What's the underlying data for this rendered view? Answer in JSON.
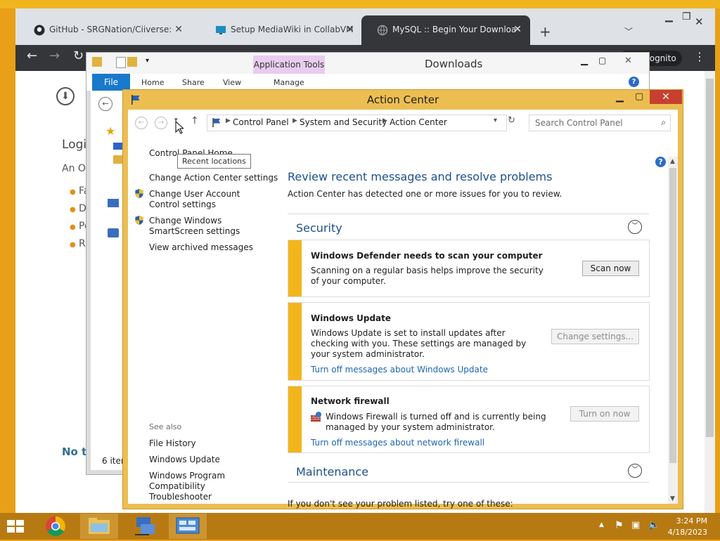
{
  "chrome": {
    "tabs": [
      {
        "title": "GitHub - SRGNation/Ciiverse: My",
        "close": "✕"
      },
      {
        "title": "Setup MediaWiki in CollabVM - C",
        "close": "✕"
      },
      {
        "title": "MySQL :: Begin Your Download",
        "close": "✕"
      }
    ],
    "new_tab": "+",
    "incognito_label": "Incognito",
    "page": {
      "heading_fragment": "Logi",
      "line_fragment": "An O",
      "bullets": [
        "Fa",
        "D",
        "Pe",
        "R"
      ],
      "footer_fragment": "No th"
    }
  },
  "explorer": {
    "title": "Downloads",
    "app_tools": "Application Tools",
    "file_tab": "File",
    "tabs": [
      "Home",
      "Share",
      "View",
      "Manage"
    ],
    "status": "6 item"
  },
  "action_center": {
    "title": "Action Center",
    "breadcrumb": [
      "Control Panel",
      "System and Security",
      "Action Center"
    ],
    "search_placeholder": "Search Control Panel",
    "tooltip": "Recent locations",
    "left_nav": {
      "home": "Control Panel Home",
      "links": [
        {
          "label": "Change Action Center settings",
          "shield": false
        },
        {
          "label": "Change User Account Control settings",
          "shield": true
        },
        {
          "label": "Change Windows SmartScreen settings",
          "shield": true
        },
        {
          "label": "View archived messages",
          "shield": false
        }
      ],
      "see_also_header": "See also",
      "see_also": [
        "File History",
        "Windows Update",
        "Windows Program Compatibility Troubleshooter"
      ]
    },
    "main": {
      "heading": "Review recent messages and resolve problems",
      "subheading": "Action Center has detected one or more issues for you to review.",
      "security_header": "Security",
      "maintenance_header": "Maintenance",
      "footer": "If you don't see your problem listed, try one of these:",
      "cards": [
        {
          "title": "Windows Defender needs to scan your computer",
          "text": "Scanning on a regular basis helps improve the security of your computer.",
          "button": "Scan now",
          "link": ""
        },
        {
          "title": "Windows Update",
          "text": "Windows Update is set to install updates after checking with you.  These settings are managed by your system administrator.",
          "button": "Change settings...",
          "link": "Turn off messages about Windows Update"
        },
        {
          "title": "Network firewall",
          "text": "Windows Firewall is turned off and is currently being managed by your system administrator.",
          "button": "Turn on now",
          "link": "Turn off messages about network firewall"
        }
      ]
    }
  },
  "taskbar": {
    "time": "3:24 PM",
    "date": "4/18/2023"
  },
  "colors": {
    "desktop": "#e9a21c",
    "action_center_frame": "#ecbe52",
    "card_accent": "#f2b51c",
    "link": "#1e65b4",
    "heading": "#1e4f8c",
    "close": "#c7402e"
  }
}
